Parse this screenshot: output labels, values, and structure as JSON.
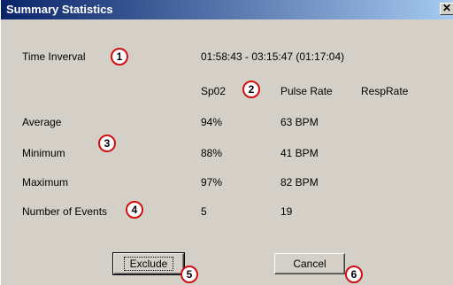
{
  "window": {
    "title": "Summary Statistics",
    "close_glyph": "✕"
  },
  "time_interval": {
    "label": "Time Inverval",
    "value": "01:58:43 - 03:15:47 (01:17:04)"
  },
  "columns": {
    "spo2": "Sp02",
    "pulse_rate": "Pulse Rate",
    "resp_rate": "RespRate"
  },
  "rows": [
    {
      "label": "Average",
      "spo2": "94%",
      "pulse_rate": "63 BPM",
      "resp_rate": ""
    },
    {
      "label": "Minimum",
      "spo2": "88%",
      "pulse_rate": "41 BPM",
      "resp_rate": ""
    },
    {
      "label": "Maximum",
      "spo2": "97%",
      "pulse_rate": "82 BPM",
      "resp_rate": ""
    },
    {
      "label": "Number of Events",
      "spo2": "5",
      "pulse_rate": "19",
      "resp_rate": ""
    }
  ],
  "callouts": [
    "1",
    "2",
    "3",
    "4",
    "5",
    "6"
  ],
  "buttons": {
    "exclude": "Exclude",
    "cancel": "Cancel"
  },
  "colors": {
    "title_start": "#0a246a",
    "title_end": "#a6caf0",
    "callout_border": "#d01010",
    "window_bg": "#d4d0c8"
  }
}
